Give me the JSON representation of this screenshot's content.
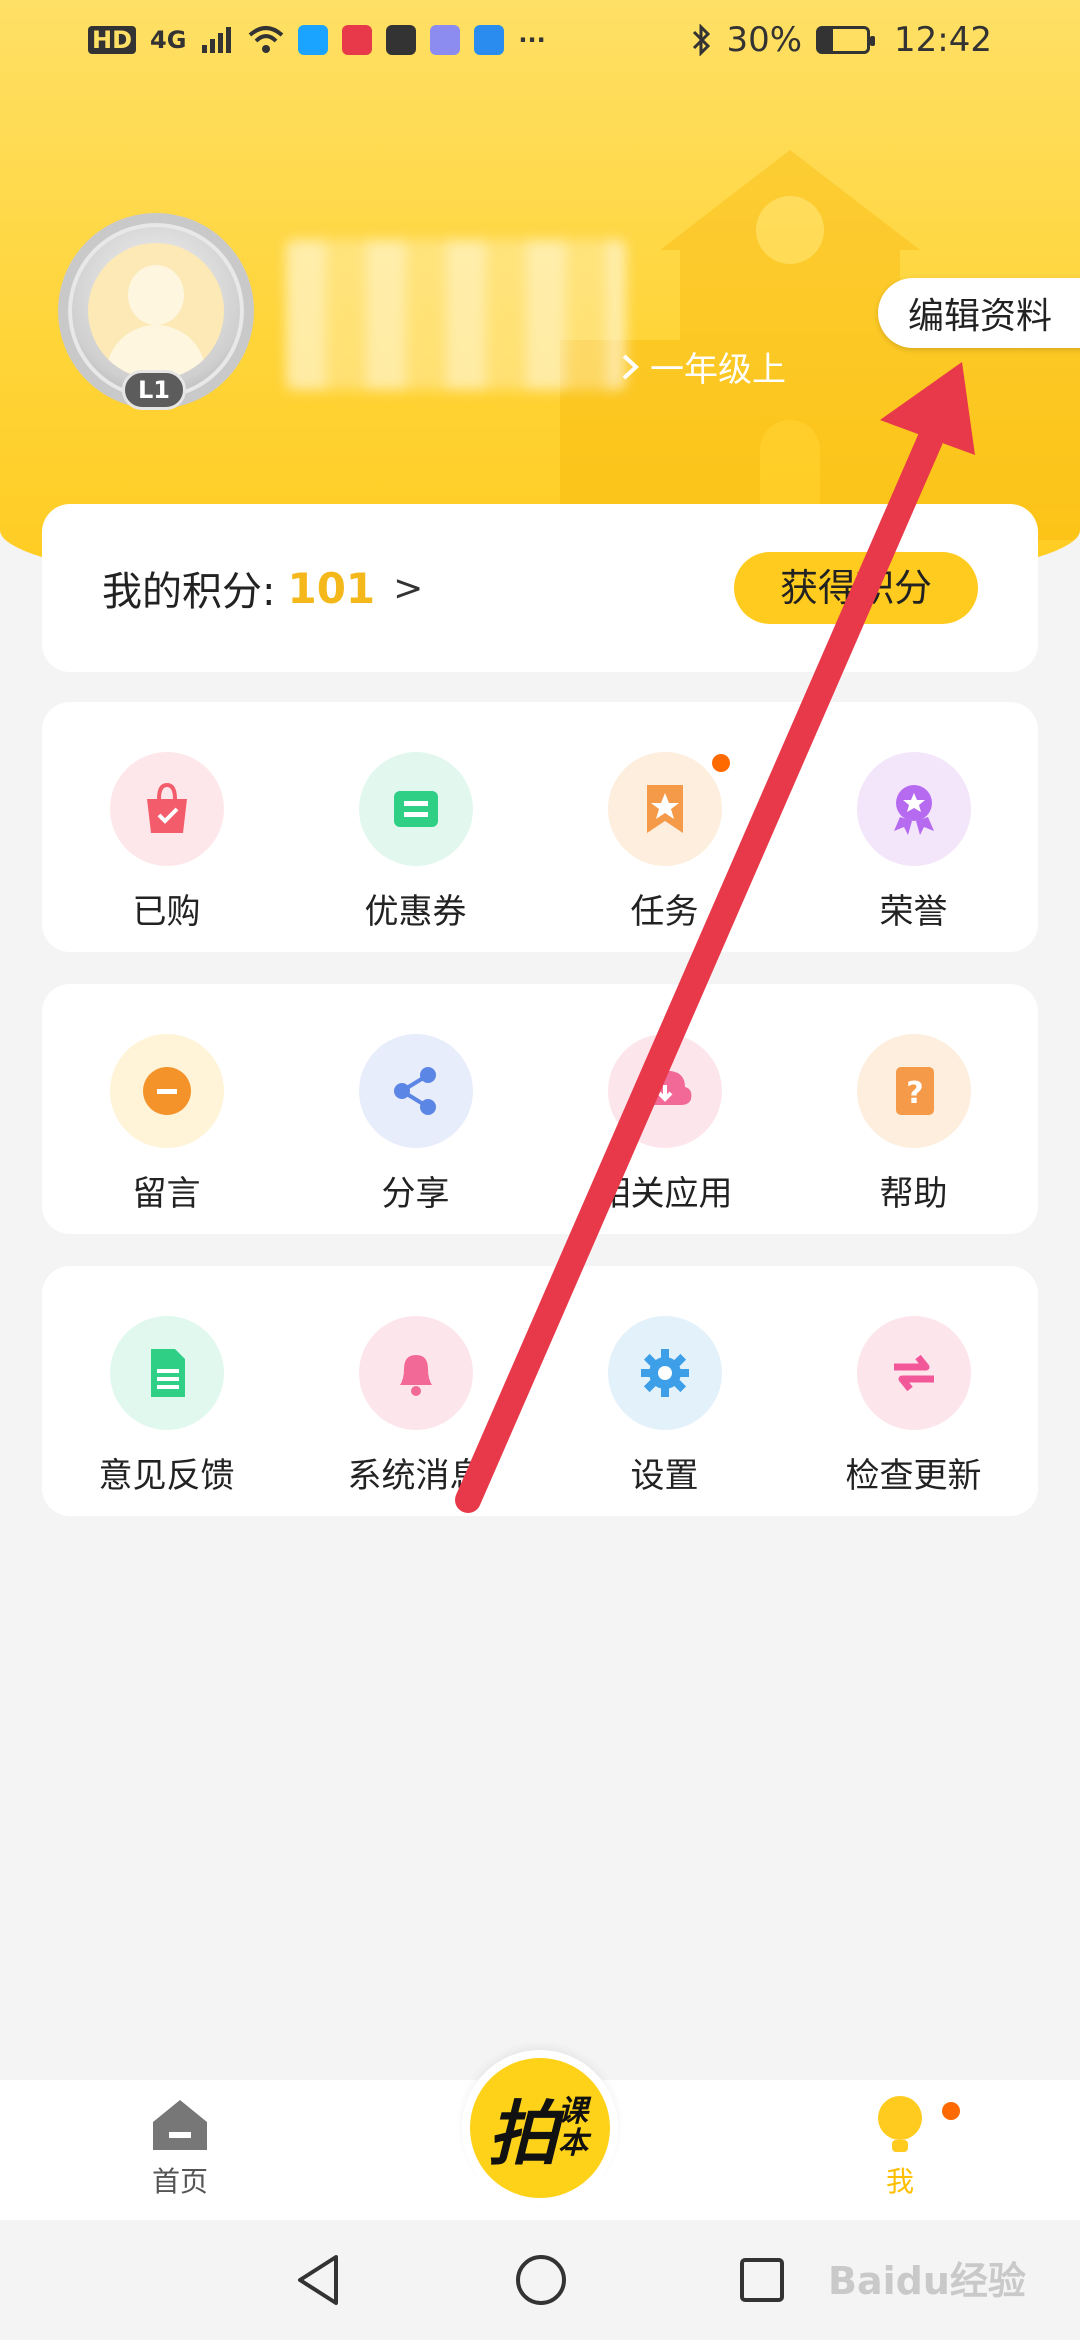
{
  "status_bar": {
    "left_text": "HD",
    "network": "4G",
    "more": "···",
    "battery": "30%",
    "battery_level": 0.3,
    "time": "12:42"
  },
  "profile": {
    "level": "L1",
    "grade": "一年级上",
    "edit_label": "编辑资料"
  },
  "points": {
    "label": "我的积分:",
    "value": "101",
    "arrow": ">",
    "earn_label": "获得积分"
  },
  "grid_rows": [
    [
      {
        "label": "已购",
        "icon": "bag-icon",
        "bg": "#fde7ea",
        "color": "#f25c6b"
      },
      {
        "label": "优惠券",
        "icon": "coupon-icon",
        "bg": "#e2f8ef",
        "color": "#2fcf86"
      },
      {
        "label": "任务",
        "icon": "task-icon",
        "bg": "#fdeedd",
        "color": "#f59a49",
        "dot": true
      },
      {
        "label": "荣誉",
        "icon": "medal-icon",
        "bg": "#f3e6fb",
        "color": "#b66af0"
      }
    ],
    [
      {
        "label": "留言",
        "icon": "message-icon",
        "bg": "#fff3d8",
        "color": "#f5932b"
      },
      {
        "label": "分享",
        "icon": "share-icon",
        "bg": "#e8edfb",
        "color": "#5b86e5"
      },
      {
        "label": "相关应用",
        "icon": "cloud-download-icon",
        "bg": "#fde5ec",
        "color": "#f26896"
      },
      {
        "label": "帮助",
        "icon": "help-icon",
        "bg": "#fdeede",
        "color": "#f59a49"
      }
    ],
    [
      {
        "label": "意见反馈",
        "icon": "feedback-icon",
        "bg": "#e0f8ee",
        "color": "#2fcf86"
      },
      {
        "label": "系统消息",
        "icon": "bell-icon",
        "bg": "#fde5ec",
        "color": "#f26896"
      },
      {
        "label": "设置",
        "icon": "gear-icon",
        "bg": "#e3f1fb",
        "color": "#3d9fe8"
      },
      {
        "label": "检查更新",
        "icon": "refresh-icon",
        "bg": "#fde5ec",
        "color": "#f2579a"
      }
    ]
  ],
  "bottom_nav": {
    "home_label": "首页",
    "center_main": "拍",
    "center_sub": "课本",
    "me_label": "我"
  },
  "watermark": "Baidu经验",
  "colors": {
    "accent": "#ffcb1f",
    "points_value": "#f5b81b",
    "arrow": "#e8394a"
  }
}
